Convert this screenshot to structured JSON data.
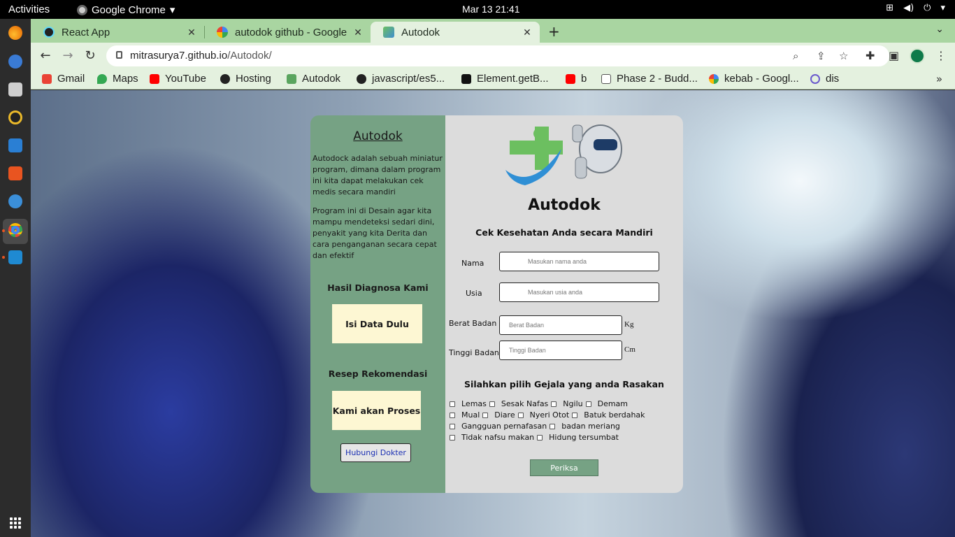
{
  "system": {
    "activities": "Activities",
    "app_name": "Google Chrome",
    "clock": "Mar 13  21:41",
    "status_icons": [
      "network-icon",
      "volume-icon",
      "power-icon"
    ]
  },
  "dock": {
    "items": [
      "firefox-icon",
      "thunderbird-icon",
      "files-icon",
      "rhythmbox-icon",
      "writer-icon",
      "software-icon",
      "help-icon",
      "chrome-icon",
      "vscode-icon",
      "show-apps-icon"
    ]
  },
  "browser": {
    "tabs": [
      {
        "title": "React App",
        "icon": "react-icon"
      },
      {
        "title": "autodok github - Google S",
        "icon": "google-icon"
      },
      {
        "title": "Autodok",
        "icon": "autodok-icon"
      }
    ],
    "url_host": "mitrasurya7.github.io",
    "url_path": "/Autodok/",
    "bookmarks": [
      {
        "label": "Gmail",
        "color": "#ea4335"
      },
      {
        "label": "Maps",
        "color": "#34a853"
      },
      {
        "label": "YouTube",
        "color": "#ff0000"
      },
      {
        "label": "Hosting",
        "color": "#222222"
      },
      {
        "label": "Autodok",
        "color": "#5aa55f"
      },
      {
        "label": "javascript/es5...",
        "color": "#222222"
      },
      {
        "label": "Element.getB...",
        "color": "#111111"
      },
      {
        "label": "b",
        "color": "#ff0000"
      },
      {
        "label": "Phase 2 - Budd...",
        "color": "#555555"
      },
      {
        "label": "kebab - Googl...",
        "color": "#4285f4"
      },
      {
        "label": "dis",
        "color": "#6a5acd"
      }
    ]
  },
  "app": {
    "sidebar": {
      "title": "Autodok",
      "desc1": "Autodock adalah sebuah miniatur program, dimana dalam program ini kita dapat melakukan cek medis secara mandiri",
      "desc2": "Program ini di Desain agar kita mampu mendeteksi sedari dini, penyakit yang kita Derita dan cara penganganan secara cepat dan efektif",
      "diagnosis_head": "Hasil Diagnosa Kami",
      "diagnosis_box": "Isi Data Dulu",
      "recipe_head": "Resep Rekomendasi",
      "recipe_box": "Kami akan Proses",
      "contact_button": "Hubungi Dokter"
    },
    "main": {
      "title": "Autodok",
      "subtitle": "Cek Kesehatan Anda secara Mandiri",
      "fields": {
        "name_label": "Nama",
        "name_placeholder": "Masukan nama anda",
        "age_label": "Usia",
        "age_placeholder": "Masukan usia anda",
        "weight_label": "Berat Badan",
        "weight_placeholder": "Berat Badan",
        "weight_unit": "Kg",
        "height_label": "Tinggi Badan",
        "height_placeholder": "Tinggi Badan",
        "height_unit": "Cm"
      },
      "symptom_head": "Silahkan pilih Gejala yang anda Rasakan",
      "symptoms": [
        "Lemas",
        "Sesak Nafas",
        "Ngilu",
        "Demam",
        "Mual",
        "Diare",
        "Nyeri Otot",
        "Batuk berdahak",
        "Gangguan pernafasan",
        "badan meriang",
        "Tidak nafsu makan",
        "Hidung tersumbat"
      ],
      "check_button": "Periksa"
    },
    "colors": {
      "sidebar_bg": "#76a284",
      "panel_bg": "#dcdcdc",
      "box_bg": "#fdf7d3"
    }
  }
}
